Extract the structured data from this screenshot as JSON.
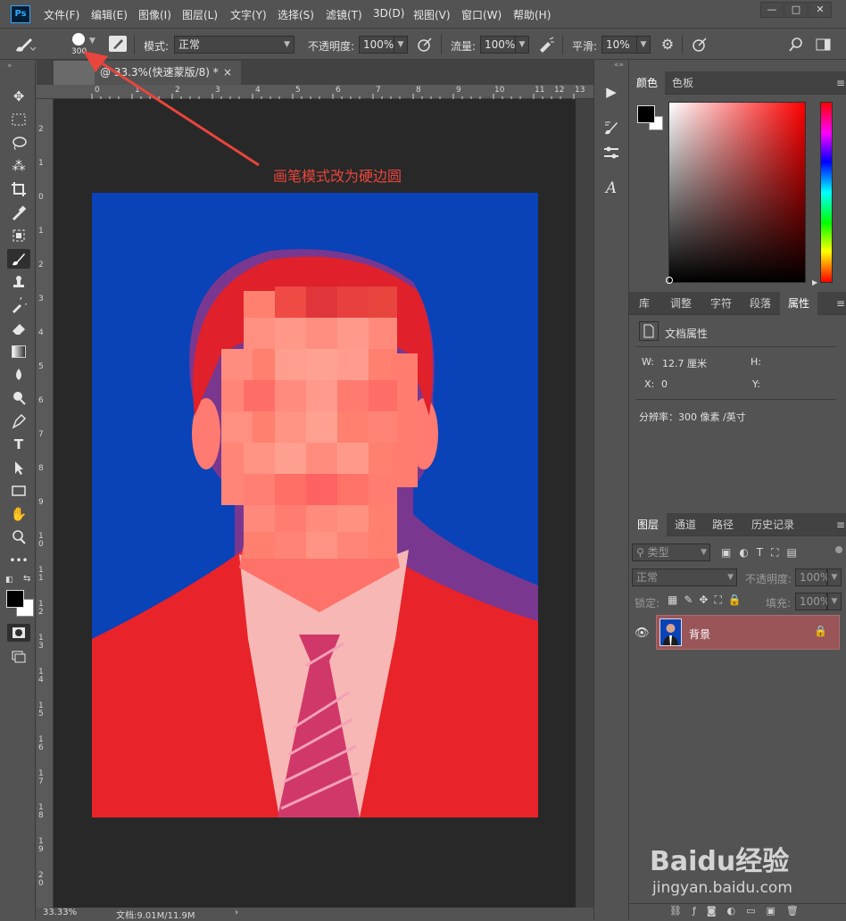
{
  "app": {
    "logo": "Ps"
  },
  "menu": [
    "文件(F)",
    "编辑(E)",
    "图像(I)",
    "图层(L)",
    "文字(Y)",
    "选择(S)",
    "滤镜(T)",
    "3D(D)",
    "视图(V)",
    "窗口(W)",
    "帮助(H)"
  ],
  "window_buttons": [
    "—",
    "□",
    "✕"
  ],
  "options": {
    "brush_size": "300",
    "mode_label": "模式:",
    "mode_value": "正常",
    "opacity_label": "不透明度:",
    "opacity_value": "100%",
    "flow_label": "流量:",
    "flow_value": "100%",
    "smooth_label": "平滑:",
    "smooth_value": "10%"
  },
  "doc_tab": {
    "title": "@ 33.3%(快速蒙版/8) *",
    "close": "×"
  },
  "ruler_top_numbers": [
    "0",
    "1",
    "2",
    "3",
    "4",
    "5",
    "6",
    "7",
    "8",
    "9",
    "10",
    "11",
    "12",
    "13"
  ],
  "ruler_left_numbers": [
    "2",
    "1",
    "0",
    "1",
    "2",
    "3",
    "4",
    "5",
    "6",
    "7",
    "8",
    "9",
    "1\n0",
    "1\n1",
    "1\n2",
    "1\n3",
    "1\n4",
    "1\n5",
    "1\n6",
    "1\n7",
    "1\n8",
    "1\n9",
    "2\n0"
  ],
  "annotation": {
    "text": "画笔模式改为硬边圆",
    "color": "#e8453c"
  },
  "status": {
    "zoom": "33.33%",
    "doc": "文档:9.01M/11.9M",
    "arrow": "›"
  },
  "color_panel": {
    "tabs": [
      "颜色",
      "色板"
    ],
    "active": 0
  },
  "props_panel": {
    "tabs": [
      "库",
      "调整",
      "字符",
      "段落",
      "属性"
    ],
    "active": 4,
    "title": "文档属性",
    "w_label": "W:",
    "w_value": "12.7 厘米",
    "h_label": "H:",
    "x_label": "X:",
    "x_value": "0",
    "y_label": "Y:",
    "resolution": "分辨率：300 像素 /英寸"
  },
  "layers_panel": {
    "tabs": [
      "图层",
      "通道",
      "路径",
      "历史记录"
    ],
    "active": 0,
    "kind": "类型",
    "blend": "正常",
    "opacity_label": "不透明度:",
    "opacity_value": "100%",
    "lock_label": "锁定:",
    "fill_label": "填充:",
    "fill_value": "100%",
    "layer_name": "背景"
  },
  "watermark": {
    "brand": "Baidu经验",
    "url": "jingyan.baidu.com"
  },
  "colors": {
    "quick_mask_red": "#e8232a",
    "photo_background": "#0a42b8",
    "foreground": "#000000",
    "background": "#ffffff"
  }
}
